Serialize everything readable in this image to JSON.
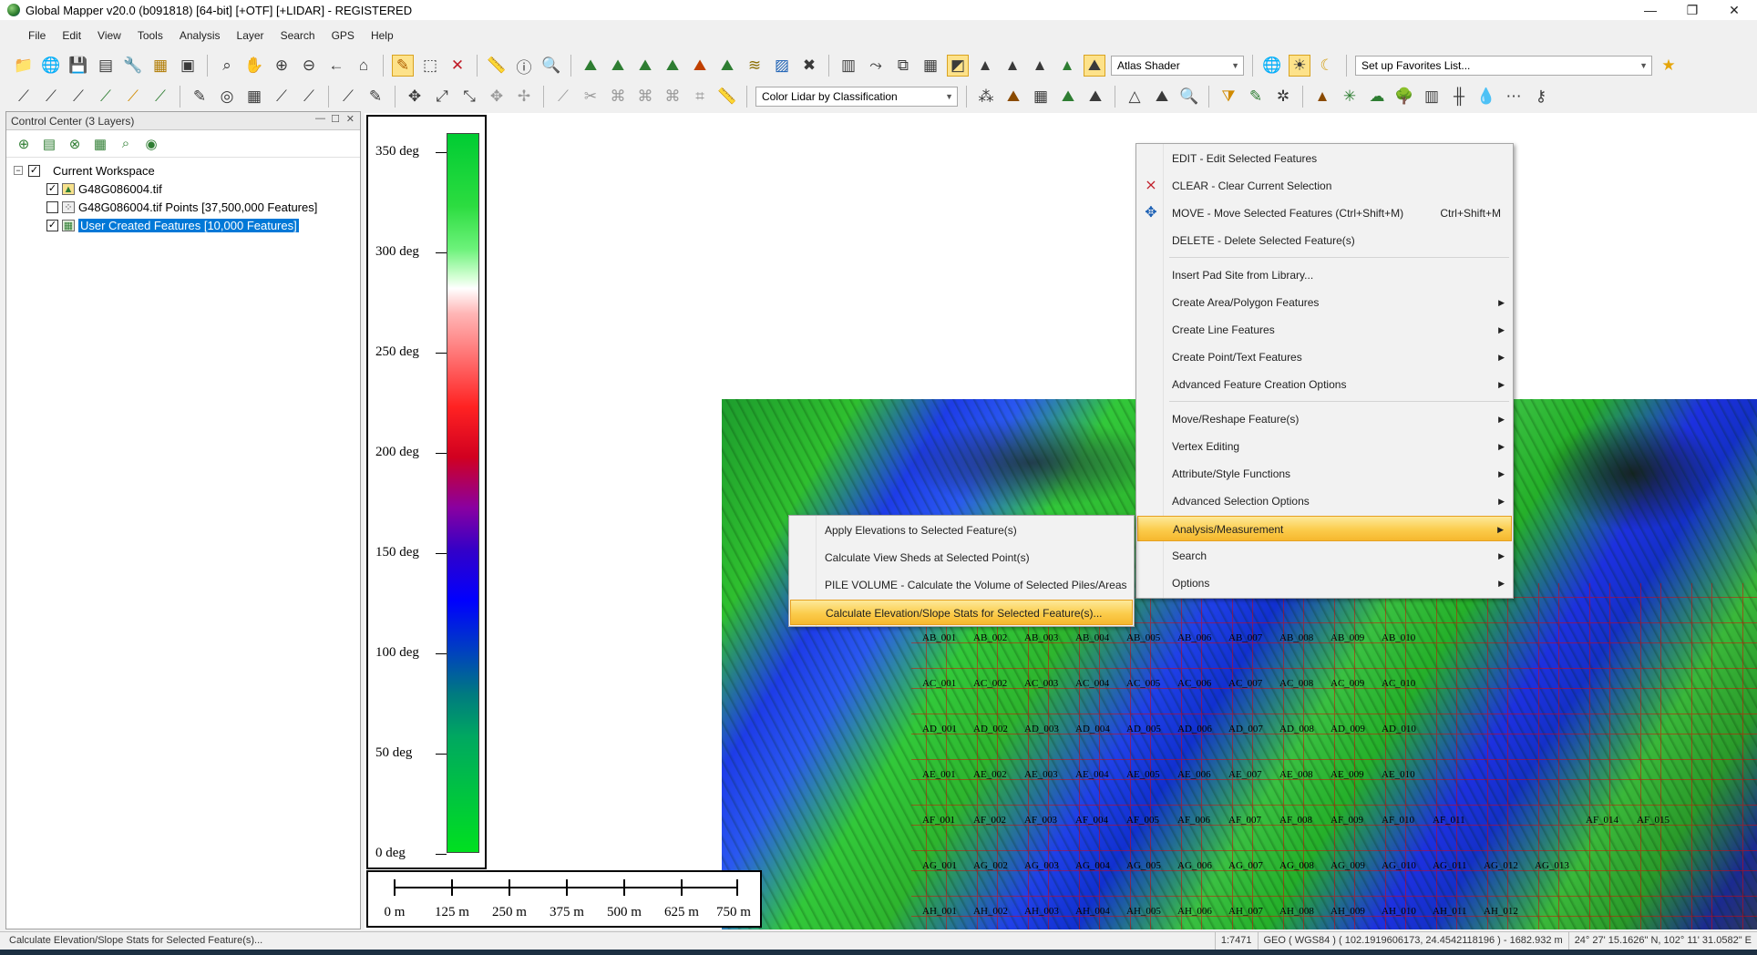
{
  "window": {
    "title": "Global Mapper v20.0 (b091818) [64-bit] [+OTF] [+LIDAR] - REGISTERED",
    "minimize": "—",
    "maximize": "❐",
    "close": "✕"
  },
  "menu": [
    "File",
    "Edit",
    "View",
    "Tools",
    "Analysis",
    "Layer",
    "Search",
    "GPS",
    "Help"
  ],
  "toolbar": {
    "shader_select": "Atlas Shader",
    "favorites_select": "Set up Favorites List...",
    "lidar_select": "Color Lidar by Classification"
  },
  "control_center": {
    "title": "Control Center (3 Layers)",
    "workspace_label": "Current Workspace",
    "layers": [
      {
        "name": "G48G086004.tif",
        "checked": true
      },
      {
        "name": "G48G086004.tif Points [37,500,000 Features]",
        "checked": false
      },
      {
        "name": "User Created Features [10,000 Features]",
        "checked": true,
        "selected": true
      }
    ]
  },
  "legend": {
    "labels": [
      "350 deg",
      "300 deg",
      "250 deg",
      "200 deg",
      "150 deg",
      "100 deg",
      "50 deg",
      "0 deg"
    ]
  },
  "scale_bar": {
    "labels": [
      "0 m",
      "125 m",
      "250 m",
      "375 m",
      "500 m",
      "625 m",
      "750 m"
    ]
  },
  "context_menu": {
    "items": [
      {
        "label": "EDIT - Edit Selected Features",
        "icon": "none"
      },
      {
        "label": "CLEAR - Clear Current Selection",
        "icon": "clear-x-icon"
      },
      {
        "label": "MOVE - Move Selected Features (Ctrl+Shift+M)",
        "shortcut": "Ctrl+Shift+M",
        "icon": "move-arrows-icon"
      },
      {
        "label": "DELETE - Delete Selected Feature(s)",
        "icon": "none"
      },
      {
        "label": "Insert Pad Site from Library...",
        "icon": "none"
      },
      {
        "label": "Create Area/Polygon Features",
        "submenu": true
      },
      {
        "label": "Create Line Features",
        "submenu": true
      },
      {
        "label": "Create Point/Text Features",
        "submenu": true
      },
      {
        "label": "Advanced Feature Creation Options",
        "submenu": true
      },
      {
        "label": "Move/Reshape Feature(s)",
        "submenu": true
      },
      {
        "label": "Vertex Editing",
        "submenu": true
      },
      {
        "label": "Attribute/Style Functions",
        "submenu": true
      },
      {
        "label": "Advanced Selection Options",
        "submenu": true
      },
      {
        "label": "Analysis/Measurement",
        "submenu": true,
        "highlighted": true
      },
      {
        "label": "Search",
        "submenu": true
      },
      {
        "label": "Options",
        "submenu": true
      }
    ]
  },
  "analysis_submenu": {
    "items": [
      {
        "label": "Apply Elevations to Selected Feature(s)"
      },
      {
        "label": "Calculate View Sheds at Selected Point(s)"
      },
      {
        "label": "PILE VOLUME - Calculate the Volume of Selected Piles/Areas"
      },
      {
        "label": "Calculate Elevation/Slope Stats for Selected Feature(s)...",
        "highlighted": true
      }
    ]
  },
  "feature_labels": [
    "AB_001",
    "AB_002",
    "AB_003",
    "AB_004",
    "AB_005",
    "AB_006",
    "AB_007",
    "AB_008",
    "AB_009",
    "AB_010",
    "AC_001",
    "AC_002",
    "AC_003",
    "AC_004",
    "AC_005",
    "AC_006",
    "AC_007",
    "AC_008",
    "AC_009",
    "AC_010",
    "AD_001",
    "AD_002",
    "AD_003",
    "AD_004",
    "AD_005",
    "AD_006",
    "AD_007",
    "AD_008",
    "AD_009",
    "AD_010",
    "AE_001",
    "AE_002",
    "AE_003",
    "AE_004",
    "AE_005",
    "AE_006",
    "AE_007",
    "AE_008",
    "AE_009",
    "AE_010",
    "AF_001",
    "AF_002",
    "AF_003",
    "AF_004",
    "AF_005",
    "AF_006",
    "AF_007",
    "AF_008",
    "AF_009",
    "AF_010",
    "AF_011",
    "AF_014",
    "AF_015",
    "AG_001",
    "AG_002",
    "AG_003",
    "AG_004",
    "AG_005",
    "AG_006",
    "AG_007",
    "AG_008",
    "AG_009",
    "AG_010",
    "AG_011",
    "AG_012",
    "AG_013",
    "AH_001",
    "AH_002",
    "AH_003",
    "AH_004",
    "AH_005",
    "AH_006",
    "AH_007",
    "AH_008",
    "AH_009",
    "AH_010",
    "AH_011",
    "AH_012"
  ],
  "status": {
    "message": "Calculate Elevation/Slope Stats for Selected Feature(s)...",
    "scale": "1:7471",
    "projection": "GEO ( WGS84 ) ( 102.1919606173, 24.4542118196 ) - 1682.932 m",
    "coordinates": "24° 27' 15.1626\" N, 102° 11' 31.0582\" E"
  }
}
